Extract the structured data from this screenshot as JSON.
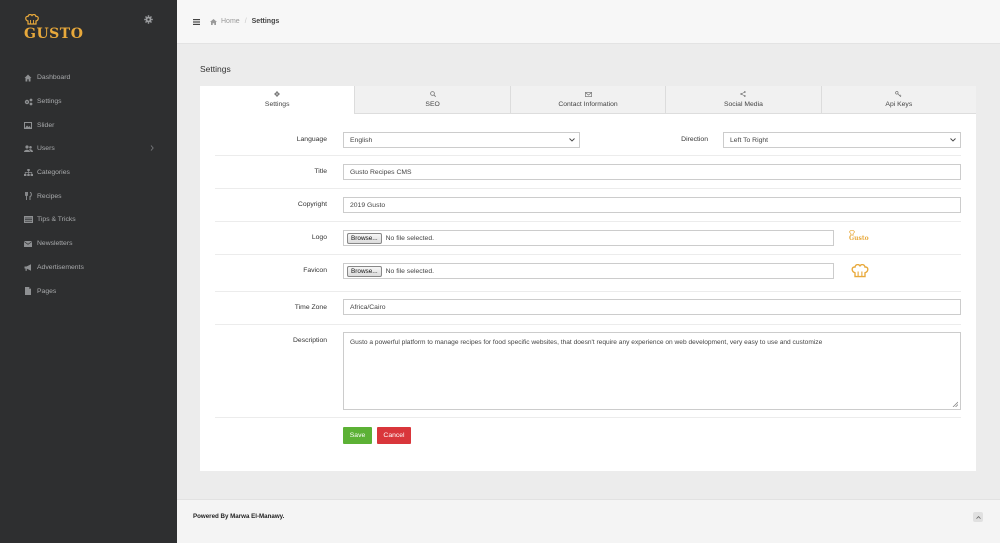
{
  "app": {
    "logo_text": "GUSTO"
  },
  "sidebar": {
    "items": [
      {
        "label": "Dashboard",
        "icon": "dashboard-icon"
      },
      {
        "label": "Settings",
        "icon": "cogs-icon"
      },
      {
        "label": "Slider",
        "icon": "image-icon"
      },
      {
        "label": "Users",
        "icon": "users-icon",
        "has_submenu": true
      },
      {
        "label": "Categories",
        "icon": "sitemap-icon"
      },
      {
        "label": "Recipes",
        "icon": "cutlery-icon"
      },
      {
        "label": "Tips & Tricks",
        "icon": "list-icon"
      },
      {
        "label": "Newsletters",
        "icon": "envelope-icon"
      },
      {
        "label": "Advertisements",
        "icon": "bullhorn-icon"
      },
      {
        "label": "Pages",
        "icon": "file-icon"
      }
    ]
  },
  "breadcrumb": {
    "home": "Home",
    "separator": "/",
    "current": "Settings"
  },
  "page": {
    "title": "Settings"
  },
  "tabs": [
    {
      "label": "Settings",
      "icon": "gear-icon",
      "active": true
    },
    {
      "label": "SEO",
      "icon": "search-icon"
    },
    {
      "label": "Contact Information",
      "icon": "envelope-icon"
    },
    {
      "label": "Social Media",
      "icon": "share-icon"
    },
    {
      "label": "Api Keys",
      "icon": "key-icon"
    }
  ],
  "form": {
    "language": {
      "label": "Language",
      "value": "English"
    },
    "direction": {
      "label": "Direction",
      "value": "Left To Right"
    },
    "title": {
      "label": "Title",
      "value": "Gusto Recipes CMS"
    },
    "copyright": {
      "label": "Copyright",
      "value": "2019 Gusto"
    },
    "logo": {
      "label": "Logo",
      "button": "Browse...",
      "status": "No file selected.",
      "preview_text": "Gusto"
    },
    "favicon": {
      "label": "Favicon",
      "button": "Browse...",
      "status": "No file selected."
    },
    "timezone": {
      "label": "Time Zone",
      "value": "Africa/Cairo"
    },
    "description": {
      "label": "Description",
      "value": "Gusto a powerful platform to manage recipes for food specific websites, that doesn't require any experience on web development, very easy to use and customize"
    },
    "save": "Save",
    "cancel": "Cancel"
  },
  "footer": {
    "text": "Powered By Marwa El-Manawy."
  },
  "colors": {
    "sidebar_bg": "#2e2f30",
    "brand": "#e8a93b",
    "save": "#5cb135",
    "cancel": "#d9363b"
  }
}
